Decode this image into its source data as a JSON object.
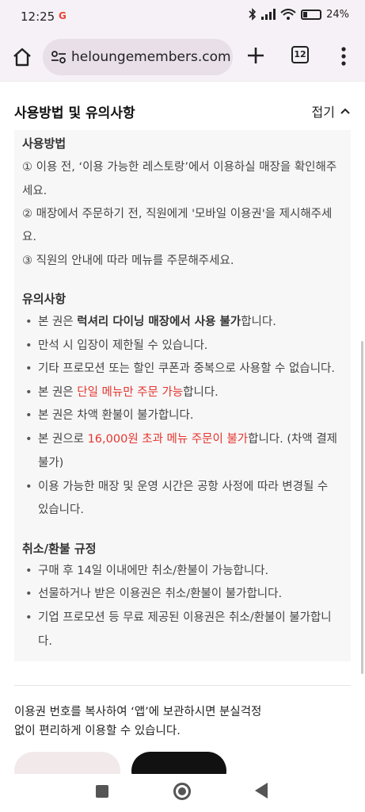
{
  "status": {
    "time": "12:25",
    "google_g": "G",
    "battery": "24%"
  },
  "browser": {
    "url": "heloungemembers.com",
    "tab_count": "12"
  },
  "section": {
    "title": "사용방법 및 유의사항",
    "collapse_label": "접기"
  },
  "usage": {
    "heading": "사용방법",
    "lines": [
      "① 이용 전, ‘이용 가능한 레스토랑’에서 이용하실 매장을 확인해주",
      "세요.",
      "② 매장에서 주문하기 전, 직원에게 '모바일 이용권'을 제시해주세",
      "요.",
      "③ 직원의 안내에 따라 메뉴를 주문해주세요."
    ]
  },
  "caution": {
    "heading": "유의사항",
    "b1": {
      "pre": "본 권은 ",
      "bold": "럭셔리 다이닝 매장에서 사용 불가",
      "post": "합니다."
    },
    "b2": "만석 시 입장이 제한될 수 있습니다.",
    "b3": "기타 프로모션 또는 할인 쿠폰과 중복으로 사용할 수 없습니다.",
    "b4": {
      "pre": "본 권은 ",
      "red": "단일 메뉴만 주문 가능",
      "post": "합니다."
    },
    "b5": "본 권은 차액 환불이 불가합니다.",
    "b6": {
      "pre": "본 권으로 ",
      "red": "16,000원 초과 메뉴 주문이 불가",
      "post": "합니다. (차액 결제",
      "line2": "불가)"
    },
    "b7": {
      "line1": "이용 가능한 매장 및 운영 시간은 공항 사정에 따라 변경될 수",
      "line2": "있습니다."
    }
  },
  "refund": {
    "heading": "취소/환불 규정",
    "b1": "구매 후 14일 이내에만 취소/환불이 가능합니다.",
    "b2": "선물하거나 받은 이용권은 취소/환불이 불가합니다.",
    "b3": {
      "line1": "기업 프로모션 등 무료 제공된 이용권은 취소/환불이 불가합니",
      "line2": "다."
    }
  },
  "notice": {
    "line1": "이용권 번호를 복사하여 ‘앱’에 보관하시면 분실걱정",
    "line2": "없이 편리하게 이용할 수 있습니다."
  },
  "colors": {
    "accent_red": "#e5352d",
    "panel_bg": "#f7f7f8"
  }
}
